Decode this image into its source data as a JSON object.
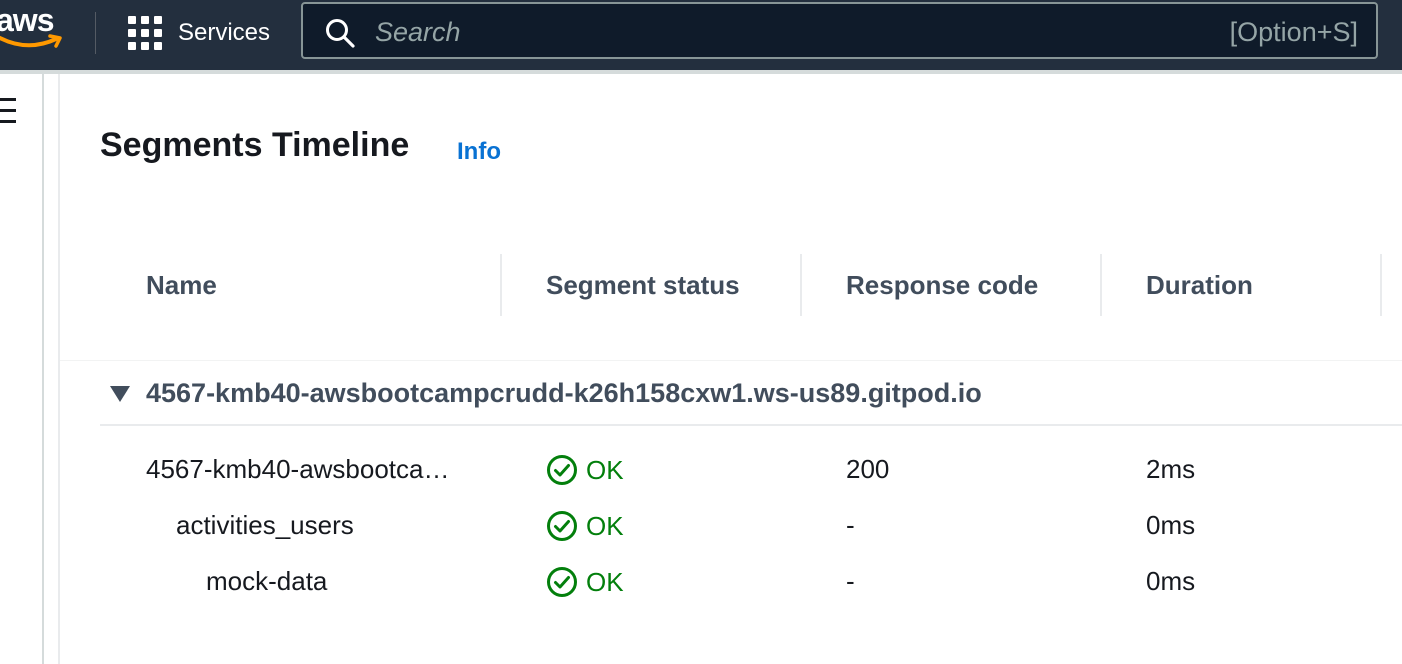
{
  "topnav": {
    "logo_text": "aws",
    "services_label": "Services",
    "search_placeholder": "Search",
    "search_shortcut": "[Option+S]"
  },
  "page": {
    "title": "Segments Timeline",
    "info_label": "Info"
  },
  "table": {
    "columns": [
      "Name",
      "Segment status",
      "Response code",
      "Duration"
    ],
    "group_title": "4567-kmb40-awsbootcampcrudd-k26h158cxw1.ws-us89.gitpod.io",
    "rows": [
      {
        "name": "4567-kmb40-awsbootca…",
        "status": "OK",
        "response_code": "200",
        "duration": "2ms"
      },
      {
        "name": "activities_users",
        "status": "OK",
        "response_code": "-",
        "duration": "0ms"
      },
      {
        "name": "mock-data",
        "status": "OK",
        "response_code": "-",
        "duration": "0ms"
      }
    ]
  },
  "colors": {
    "nav_bg": "#232f3e",
    "link_blue": "#0972d3",
    "status_green": "#037f0c",
    "aws_orange": "#ff9900"
  },
  "icons": {
    "logo": "aws-smile-logo",
    "services": "grid-icon",
    "search": "search-icon",
    "menu": "hamburger-icon",
    "group_toggle": "caret-down-icon",
    "status_ok": "check-circle-icon"
  }
}
